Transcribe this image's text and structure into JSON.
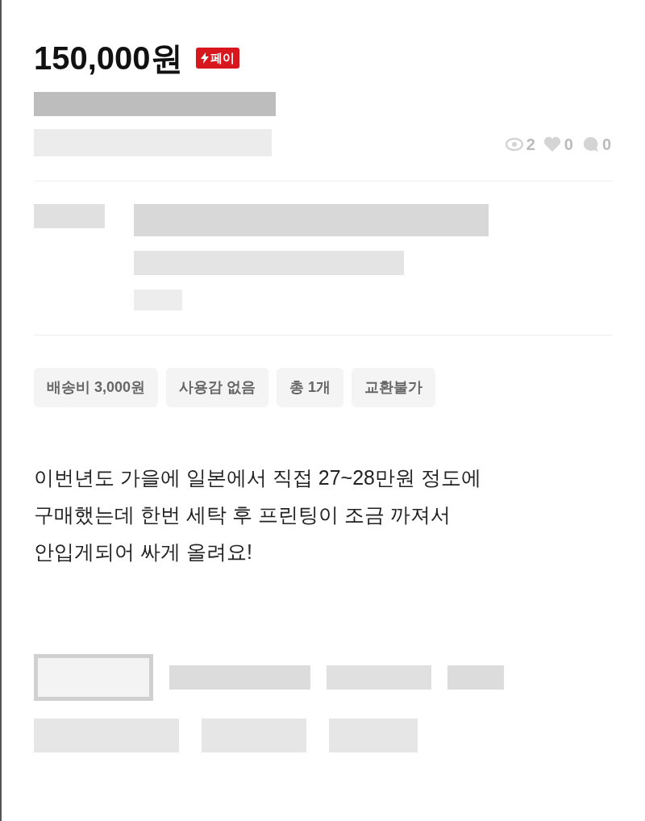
{
  "price": "150,000원",
  "pay_badge": "페이",
  "stats": [
    {
      "kind": "views",
      "count": "2"
    },
    {
      "kind": "likes",
      "count": "0"
    },
    {
      "kind": "chats",
      "count": "0"
    }
  ],
  "tags": [
    "배송비 3,000원",
    "사용감 없음",
    "총 1개",
    "교환불가"
  ],
  "description": [
    "이번년도 가을에 일본에서 직접 27~28만원 정도에",
    "구매했는데 한번 세탁 후 프린팅이 조금 까져서",
    "안입게되어 싸게 올려요!"
  ]
}
